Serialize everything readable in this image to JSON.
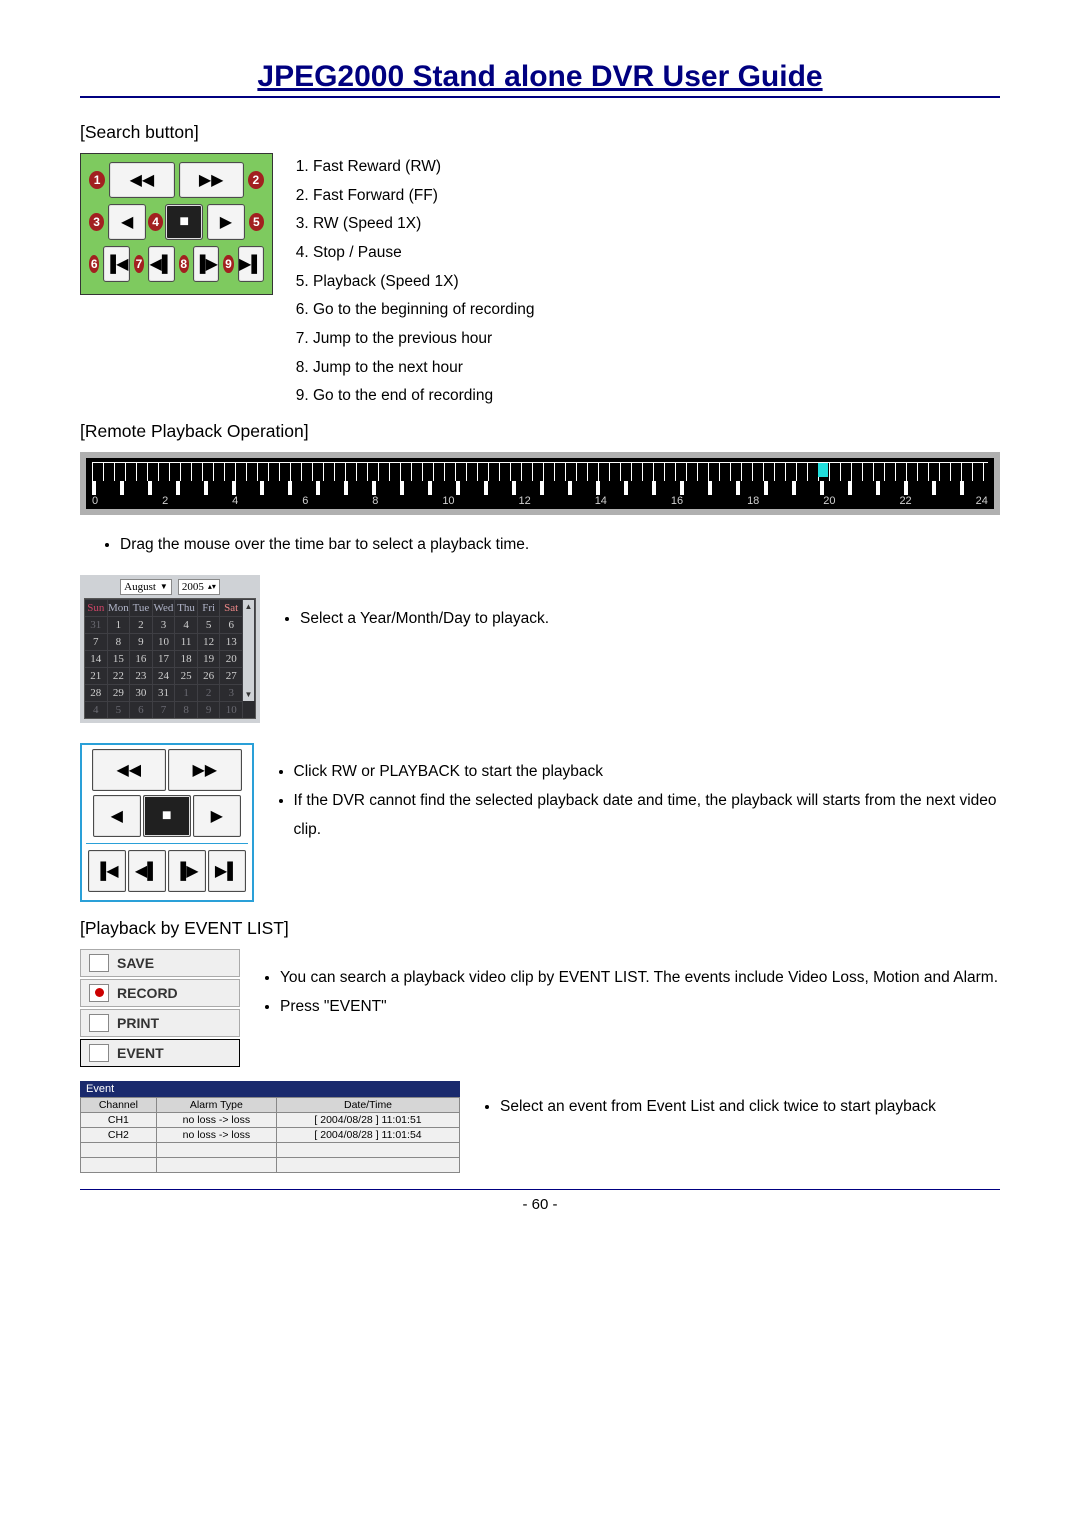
{
  "header": {
    "title": "JPEG2000  Stand  alone  DVR  User  Guide"
  },
  "search_button": {
    "heading": "[Search button]",
    "items": [
      "Fast Reward (RW)",
      "Fast Forward (FF)",
      "RW (Speed 1X)",
      "Stop / Pause",
      "Playback (Speed 1X)",
      "Go to the beginning of recording",
      "Jump to the previous hour",
      "Jump to the next hour",
      "Go to the end of recording"
    ]
  },
  "remote_playback": {
    "heading": "[Remote Playback Operation]",
    "tick_labels": [
      "0",
      "2",
      "4",
      "6",
      "8",
      "10",
      "12",
      "14",
      "16",
      "18",
      "20",
      "22",
      "24"
    ],
    "bullet1": "Drag the mouse over the time bar to select a playback time."
  },
  "calendar": {
    "month": "August",
    "year": "2005",
    "week_heads": [
      "Sun",
      "Mon",
      "Tue",
      "Wed",
      "Thu",
      "Fri",
      "Sat"
    ],
    "rows": [
      [
        "31",
        "1",
        "2",
        "3",
        "4",
        "5",
        "6"
      ],
      [
        "7",
        "8",
        "9",
        "10",
        "11",
        "12",
        "13"
      ],
      [
        "14",
        "15",
        "16",
        "17",
        "18",
        "19",
        "20"
      ],
      [
        "21",
        "22",
        "23",
        "24",
        "25",
        "26",
        "27"
      ],
      [
        "28",
        "29",
        "30",
        "31",
        "1",
        "2",
        "3"
      ],
      [
        "4",
        "5",
        "6",
        "7",
        "8",
        "9",
        "10"
      ]
    ],
    "bullet": "Select a Year/Month/Day to playack."
  },
  "playback2": {
    "bullets": [
      "Click RW or PLAYBACK to start the playback",
      "If the DVR cannot find the selected playback date and time, the playback will starts from the next video clip."
    ]
  },
  "event_list": {
    "heading": "[Playback by EVENT LIST]",
    "buttons": {
      "save": "SAVE",
      "record": "RECORD",
      "print": "PRINT",
      "event": "EVENT"
    },
    "bullets": [
      "You can search a playback video clip by EVENT LIST. The events include Video Loss, Motion and Alarm.",
      "Press \"EVENT\""
    ],
    "title": "Event",
    "cols": [
      "Channel",
      "Alarm Type",
      "Date/Time"
    ],
    "rows": [
      [
        "CH1",
        "no loss -> loss",
        "[ 2004/08/28 ] 11:01:51"
      ],
      [
        "CH2",
        "no loss -> loss",
        "[ 2004/08/28 ] 11:01:54"
      ]
    ],
    "bullet2": "Select an event from Event List and click twice to start playback"
  },
  "page_number": "- 60 -"
}
